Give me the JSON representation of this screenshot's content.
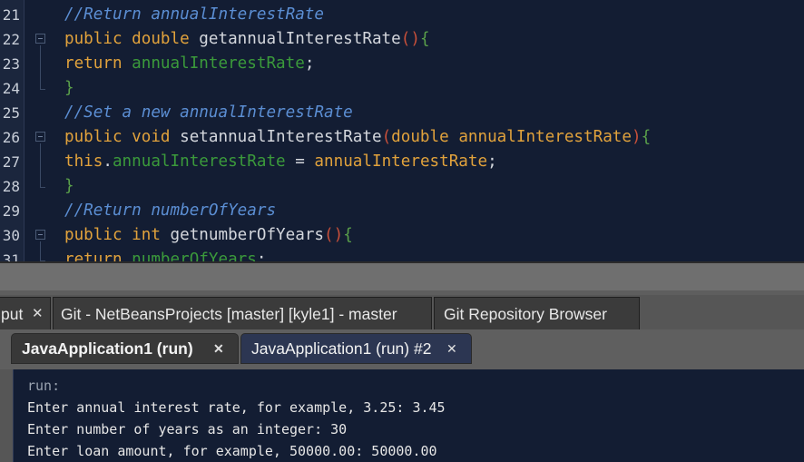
{
  "editor": {
    "lines": [
      {
        "num": "21",
        "tokens": [
          {
            "t": "//Return annualInterestRate",
            "c": "cmt"
          }
        ]
      },
      {
        "num": "22",
        "fold": true,
        "tokens": [
          {
            "t": "public double ",
            "c": "kw"
          },
          {
            "t": "getannualInterestRate",
            "c": "punct"
          },
          {
            "t": "()",
            "c": "brace-o"
          },
          {
            "t": "{",
            "c": "brace-g"
          }
        ]
      },
      {
        "num": "23",
        "tokens": [
          {
            "t": "return ",
            "c": "kw"
          },
          {
            "t": "annualInterestRate",
            "c": "fld"
          },
          {
            "t": ";",
            "c": "punct"
          }
        ]
      },
      {
        "num": "24",
        "tokens": [
          {
            "t": "}",
            "c": "brace-g"
          }
        ]
      },
      {
        "num": "25",
        "tokens": [
          {
            "t": "//Set a new annualInterestRate",
            "c": "cmt"
          }
        ]
      },
      {
        "num": "26",
        "fold": true,
        "tokens": [
          {
            "t": "public void ",
            "c": "kw"
          },
          {
            "t": "setannualInterestRate",
            "c": "punct"
          },
          {
            "t": "(",
            "c": "brace-o"
          },
          {
            "t": "double ",
            "c": "kw"
          },
          {
            "t": "annualInterestRate",
            "c": "par"
          },
          {
            "t": ")",
            "c": "brace-o"
          },
          {
            "t": "{",
            "c": "brace-g"
          }
        ]
      },
      {
        "num": "27",
        "tokens": [
          {
            "t": "this",
            "c": "kw"
          },
          {
            "t": ".",
            "c": "punct"
          },
          {
            "t": "annualInterestRate",
            "c": "fld"
          },
          {
            "t": " = ",
            "c": "punct"
          },
          {
            "t": "annualInterestRate",
            "c": "par"
          },
          {
            "t": ";",
            "c": "punct"
          }
        ]
      },
      {
        "num": "28",
        "tokens": [
          {
            "t": "}",
            "c": "brace-g"
          }
        ]
      },
      {
        "num": "29",
        "tokens": [
          {
            "t": "//Return numberOfYears",
            "c": "cmt"
          }
        ]
      },
      {
        "num": "30",
        "fold": true,
        "tokens": [
          {
            "t": "public int ",
            "c": "kw"
          },
          {
            "t": "getnumberOfYears",
            "c": "punct"
          },
          {
            "t": "()",
            "c": "brace-o"
          },
          {
            "t": "{",
            "c": "brace-g"
          }
        ]
      },
      {
        "num": "31",
        "tokens": [
          {
            "t": "return ",
            "c": "kw"
          },
          {
            "t": "numberOfYears",
            "c": "fld"
          },
          {
            "t": ";",
            "c": "punct"
          }
        ]
      }
    ]
  },
  "panel": {
    "top_tabs": [
      {
        "label": "put",
        "closable": true
      },
      {
        "label": "Git - NetBeansProjects [master] [kyle1] - master",
        "closable": false
      },
      {
        "label": "Git Repository Browser",
        "closable": false
      }
    ],
    "sub_tabs": [
      {
        "label": "JavaApplication1 (run)",
        "active": true
      },
      {
        "label": "JavaApplication1 (run) #2",
        "active": false
      }
    ],
    "close_glyph": "✕",
    "console": [
      "run:",
      "Enter annual interest rate, for example, 3.25: 3.45",
      "Enter number of years as an integer: 30",
      "Enter loan amount, for example, 50000.00: 50000.00"
    ]
  }
}
